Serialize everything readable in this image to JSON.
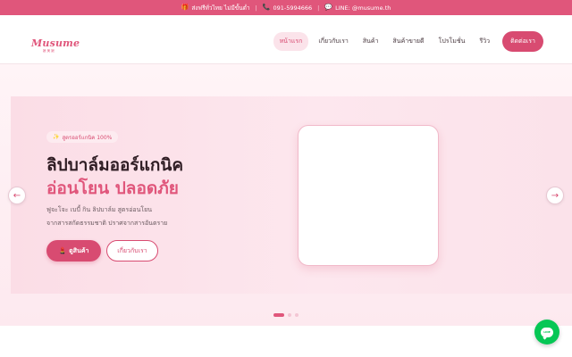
{
  "topbar": {
    "shipping_icon": "gift-icon",
    "shipping_text": "ส่งฟรีทั่วไทย ไม่มีขั้นต่ำ",
    "phone_icon": "phone-icon",
    "phone_text": "091-5994666",
    "line_icon": "chat-icon",
    "line_text": "LINE: @musume.th",
    "separator": "|"
  },
  "header": {
    "logo_text": "Musume",
    "logo_sub": "娘 美 娘",
    "nav": [
      {
        "label": "หน้าแรก",
        "active": true
      },
      {
        "label": "เกี่ยวกับเรา"
      },
      {
        "label": "สินค้า"
      },
      {
        "label": "สินค้าขายดี"
      },
      {
        "label": "โปรโมชั่น"
      },
      {
        "label": "รีวิว"
      }
    ],
    "cta_label": "ติดต่อเรา"
  },
  "hero": {
    "badge_icon": "sparkle-icon",
    "badge_text": "สูตรออร์แกนิค 100%",
    "title_line1": "ลิปบาล์มออร์แกนิค",
    "title_line2": "อ่อนโยน ปลอดภัย",
    "desc_line1": "ฟูจะโจะ เบบี้ กิน ลิปบาล์ม สูตรอ่อนโยน",
    "desc_line2": "จากสารสกัดธรรมชาติ ปราศจากสารอันตราย",
    "primary_icon": "lipstick-icon",
    "primary_label": "ดูสินค้า",
    "secondary_label": "เกี่ยวกับเรา",
    "prev_arrow": "←",
    "next_arrow": "→"
  },
  "carousel": {
    "slide_count": 3,
    "active_index": 0
  },
  "chat": {
    "icon": "line-chat-icon",
    "label": "LINE"
  },
  "colors": {
    "brand": "#e0567b",
    "brand_dark": "#d84b71",
    "line_green": "#06c755"
  }
}
